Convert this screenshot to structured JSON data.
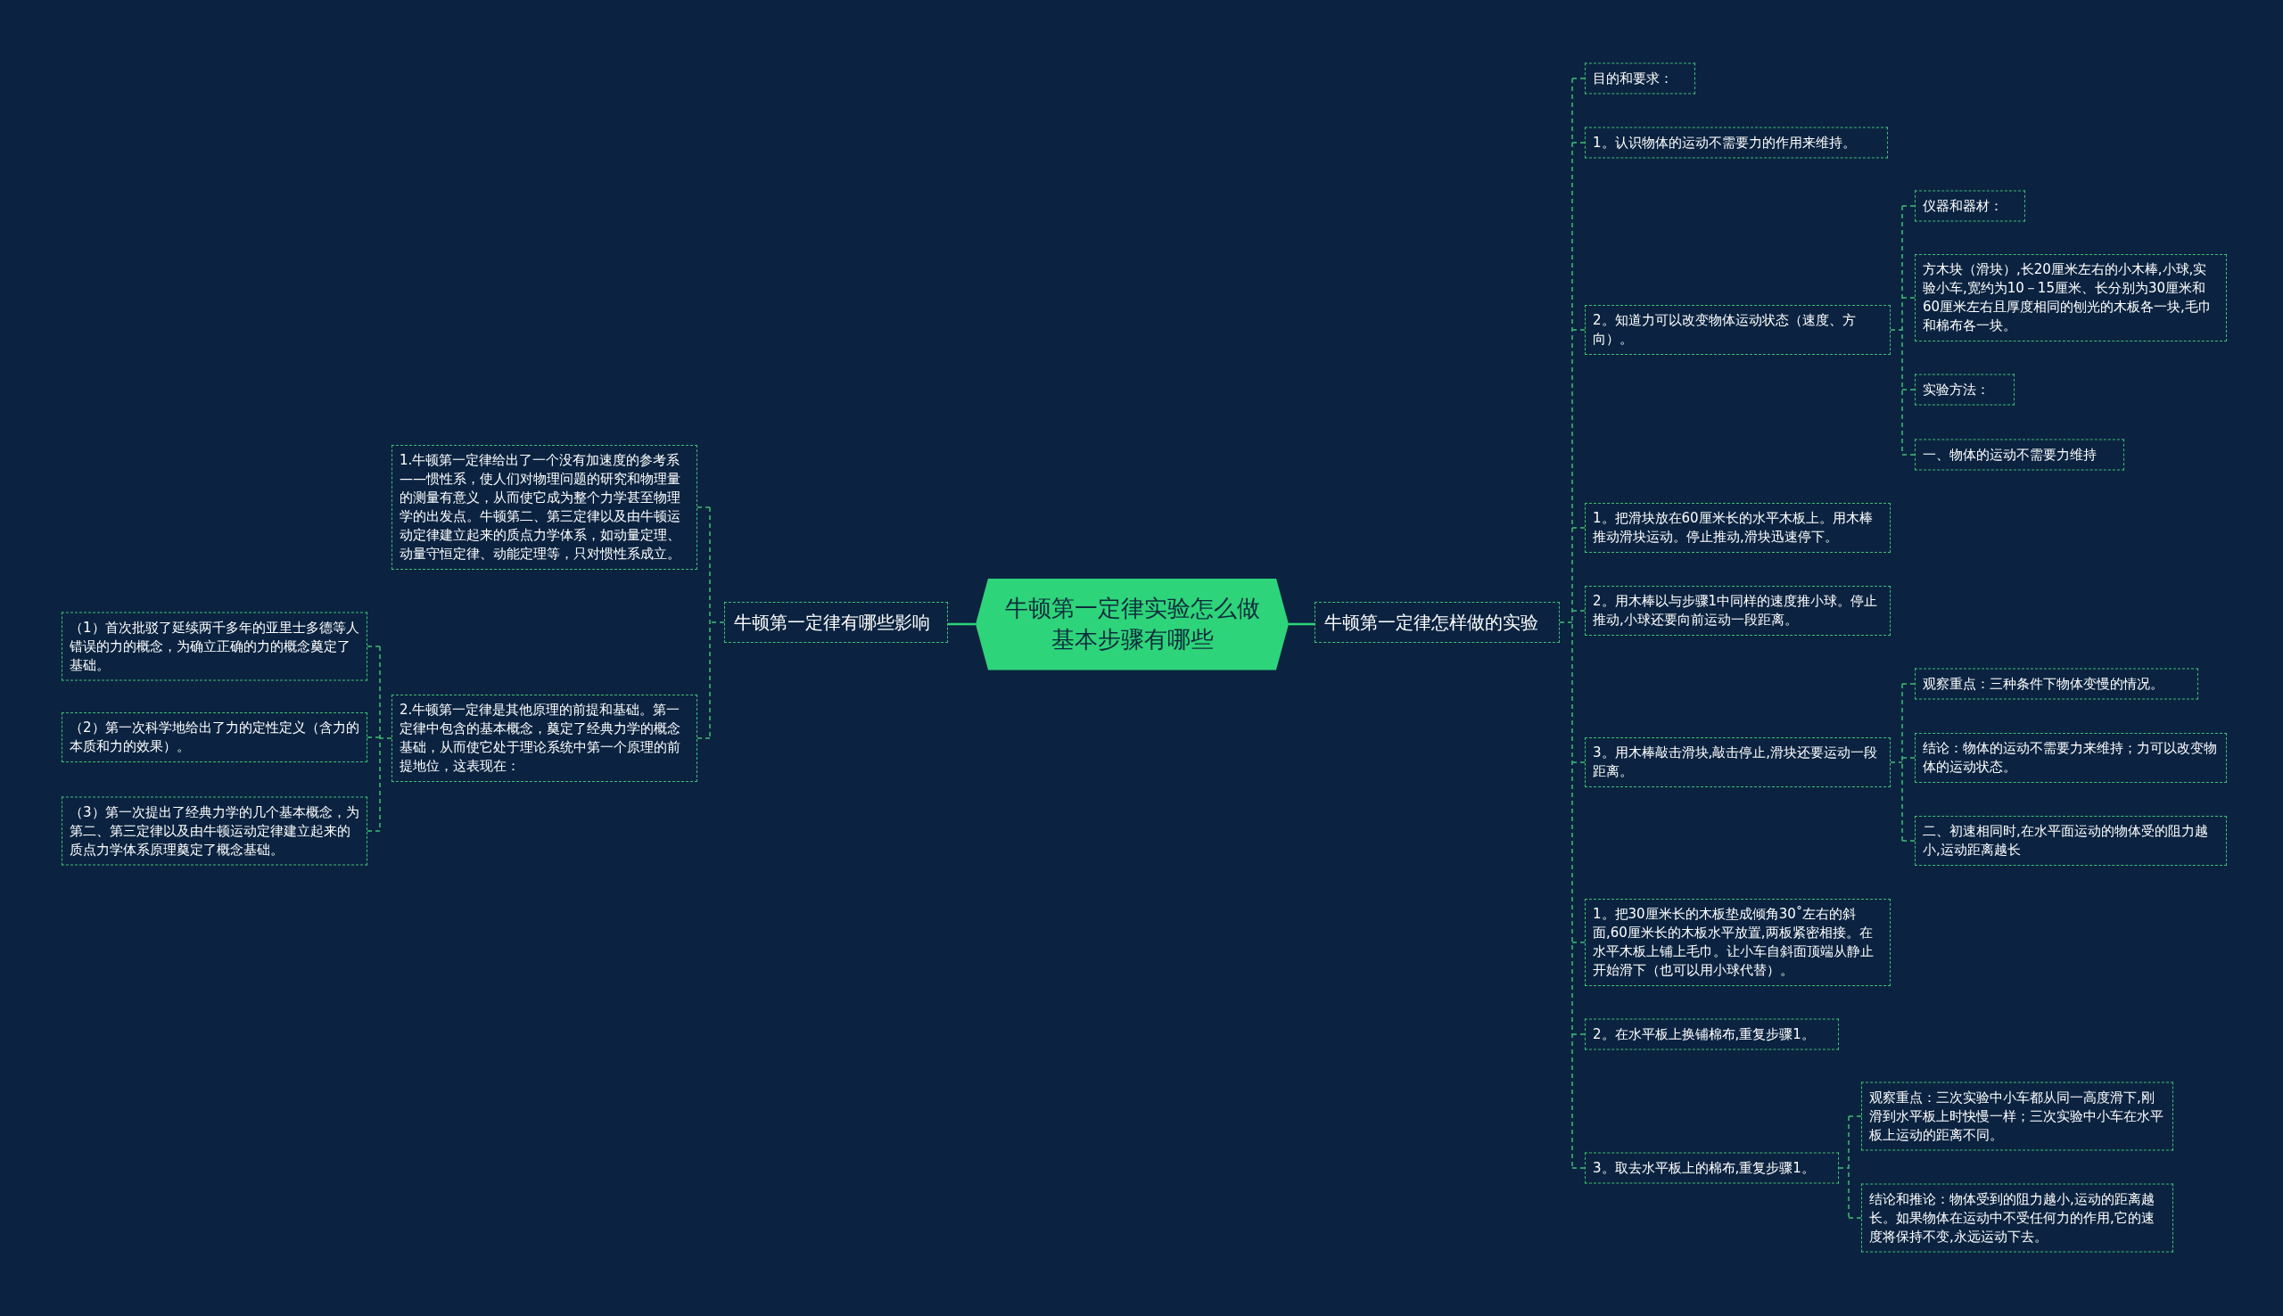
{
  "mind_map": {
    "root": {
      "lines": [
        "牛顿第一定律实验怎么做",
        "基本步骤有哪些"
      ]
    },
    "branches": [
      {
        "text": "牛顿第一定律有哪些影响",
        "children": [
          {
            "text": "1.牛顿第一定律给出了一个没有加速度的参考系——惯性系，使人们对物理问题的研究和物理量的测量有意义，从而使它成为整个力学甚至物理学的出发点。牛顿第二、第三定律以及由牛顿运动定律建立起来的质点力学体系，如动量定理、动量守恒定律、动能定理等，只对惯性系成立。"
          },
          {
            "text": "2.牛顿第一定律是其他原理的前提和基础。第一定律中包含的基本概念，奠定了经典力学的概念基础，从而使它处于理论系统中第一个原理的前提地位，这表现在：",
            "children": [
              {
                "text": "（1）首次批驳了延续两千多年的亚里士多德等人错误的力的概念，为确立正确的力的概念奠定了基础。"
              },
              {
                "text": "（2）第一次科学地给出了力的定性定义（含力的本质和力的效果）。"
              },
              {
                "text": "（3）第一次提出了经典力学的几个基本概念，为第二、第三定律以及由牛顿运动定律建立起来的质点力学体系原理奠定了概念基础。"
              }
            ]
          }
        ]
      },
      {
        "text": "牛顿第一定律怎样做的实验",
        "children": [
          {
            "text": "目的和要求："
          },
          {
            "text": "1。认识物体的运动不需要力的作用来维持。"
          },
          {
            "text": "2。知道力可以改变物体运动状态（速度、方向）。",
            "children": [
              {
                "text": "仪器和器材："
              },
              {
                "text": "方木块（滑块）,长20厘米左右的小木棒,小球,实验小车,宽约为10－15厘米、长分别为30厘米和60厘米左右且厚度相同的刨光的木板各一块,毛巾和棉布各一块。"
              },
              {
                "text": "实验方法："
              },
              {
                "text": "一、物体的运动不需要力维持"
              }
            ]
          },
          {
            "text": "1。把滑块放在60厘米长的水平木板上。用木棒推动滑块运动。停止推动,滑块迅速停下。"
          },
          {
            "text": "2。用木棒以与步骤1中同样的速度推小球。停止推动,小球还要向前运动一段距离。"
          },
          {
            "text": "3。用木棒敲击滑块,敲击停止,滑块还要运动一段距离。",
            "children": [
              {
                "text": "观察重点：三种条件下物体变慢的情况。"
              },
              {
                "text": "结论：物体的运动不需要力来维持；力可以改变物体的运动状态。"
              },
              {
                "text": "二、初速相同时,在水平面运动的物体受的阻力越小,运动距离越长"
              }
            ]
          },
          {
            "text": "1。把30厘米长的木板垫成倾角30˚左右的斜面,60厘米长的木板水平放置,两板紧密相接。在水平木板上铺上毛巾。让小车自斜面顶端从静止开始滑下（也可以用小球代替）。"
          },
          {
            "text": "2。在水平板上换铺棉布,重复步骤1。"
          },
          {
            "text": "3。取去水平板上的棉布,重复步骤1。",
            "children": [
              {
                "text": "观察重点：三次实验中小车都从同一高度滑下,刚滑到水平板上时快慢一样；三次实验中小车在水平板上运动的距离不同。"
              },
              {
                "text": "结论和推论：物体受到的阻力越小,运动的距离越长。如果物体在运动中不受任何力的作用,它的速度将保持不变,永远运动下去。"
              }
            ]
          }
        ]
      }
    ]
  }
}
